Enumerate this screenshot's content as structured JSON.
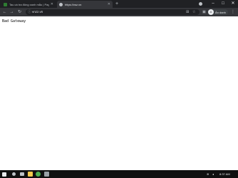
{
  "tabs": [
    {
      "title": "Tau cá tra đông xanh mẫu | Page 2",
      "favicon_color": "#2e7d32",
      "active": false
    },
    {
      "title": "https://vsz.vn",
      "favicon_color": "#bdc1c6",
      "active": true
    }
  ],
  "new_tab_icon": "+",
  "window_controls": {
    "minimize": "–",
    "maximize": "□",
    "close": "✕"
  },
  "address_bar": {
    "url": "vnzz.vn"
  },
  "profile": {
    "initial": "A",
    "name": "Ẩn danh"
  },
  "page": {
    "body_text": "Bad Gateway"
  },
  "taskbar": {
    "time": "8:37 AM",
    "items": [
      {
        "name": "start",
        "color": "#e8eaed"
      },
      {
        "name": "search",
        "color": "#bdc1c6"
      },
      {
        "name": "task-view",
        "color": "#bdc1c6"
      },
      {
        "name": "explorer",
        "color": "#f2c94c"
      },
      {
        "name": "chrome",
        "color": "#4caf50"
      },
      {
        "name": "app",
        "color": "#9aa0a6"
      }
    ]
  },
  "colors": {
    "accent": "#35363a",
    "tabstrip": "#202124"
  }
}
